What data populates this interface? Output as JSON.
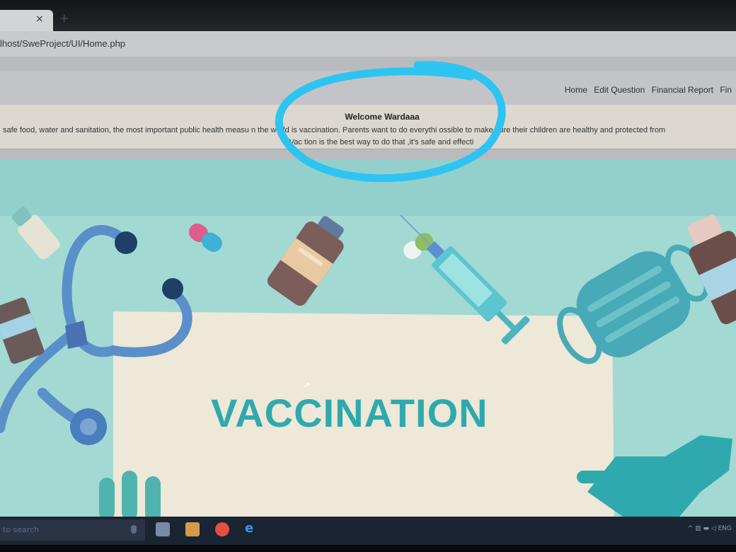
{
  "browser": {
    "url": "lhost/SweProject/UI/Home.php",
    "tab_close_icon": "×",
    "new_tab_icon": "+"
  },
  "nav": {
    "items": [
      "Home",
      "Edit Question",
      "Financial Report",
      "Fin"
    ]
  },
  "banner": {
    "welcome": "Welcome Wardaaa",
    "intro_line1": "safe food, water and sanitation, the most important public health measu  n the world is vaccination. Parents want to do everythi   ossible to make sure their children are healthy and protected from",
    "intro_line2": "Vac   tion is the best way to do that ,it's safe and effecti"
  },
  "hero": {
    "title": "VACCINATION"
  },
  "taskbar": {
    "search_placeholder": "to search",
    "tray_language": "ENG"
  },
  "colors": {
    "hero_bg": "#9fd6d0",
    "title": "#2fa9ae",
    "annotation_circle": "#2ec4f2"
  }
}
